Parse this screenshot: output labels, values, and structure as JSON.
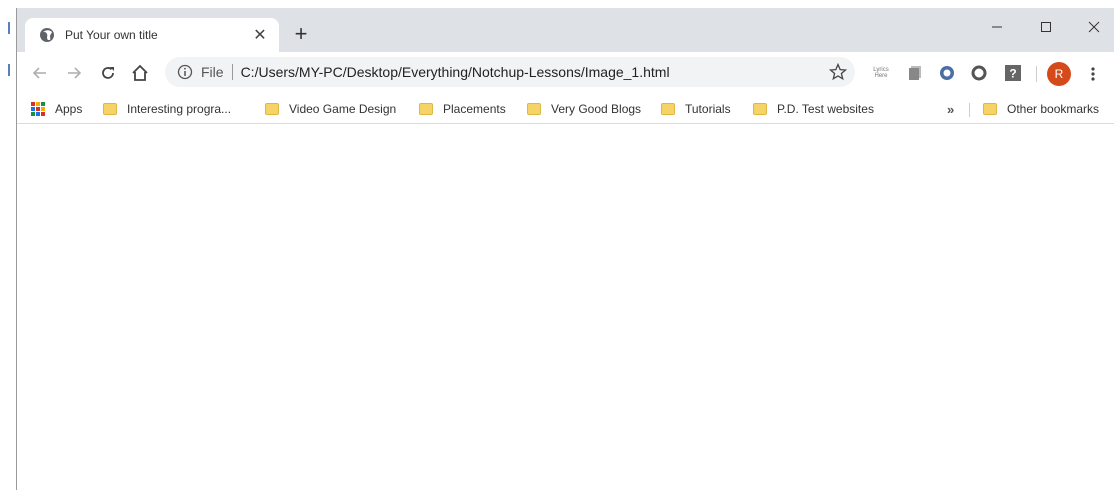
{
  "tab": {
    "title": "Put Your own title",
    "close_glyph": "✕",
    "favicon_icon": "globe-icon"
  },
  "newtab_glyph": "+",
  "window_controls": {
    "minimize_icon": "minimize-icon",
    "maximize_icon": "maximize-icon",
    "close_icon": "close-icon"
  },
  "toolbar": {
    "back_icon": "arrow-left-icon",
    "forward_icon": "arrow-right-icon",
    "reload_icon": "reload-icon",
    "home_icon": "home-icon"
  },
  "omnibox": {
    "scheme": "File",
    "url": "C:/Users/MY-PC/Desktop/Everything/Notchup-Lessons/Image_1.html",
    "info_icon": "info-icon",
    "star_icon": "star-icon"
  },
  "extensions": {
    "lyrics_label": "Lyrics Here",
    "help_glyph": "?",
    "avatar_letter": "R"
  },
  "bookmarks": {
    "apps": "Apps",
    "items": [
      "Interesting progra...",
      "Video Game Design",
      "Placements",
      "Very Good Blogs",
      "Tutorials",
      "P.D. Test websites"
    ],
    "overflow": "»",
    "other": "Other bookmarks"
  },
  "colors": {
    "tabstrip": "#dee1e6",
    "omnibox": "#f1f3f4",
    "avatar": "#d44a1a",
    "folder": "#f5d367"
  }
}
